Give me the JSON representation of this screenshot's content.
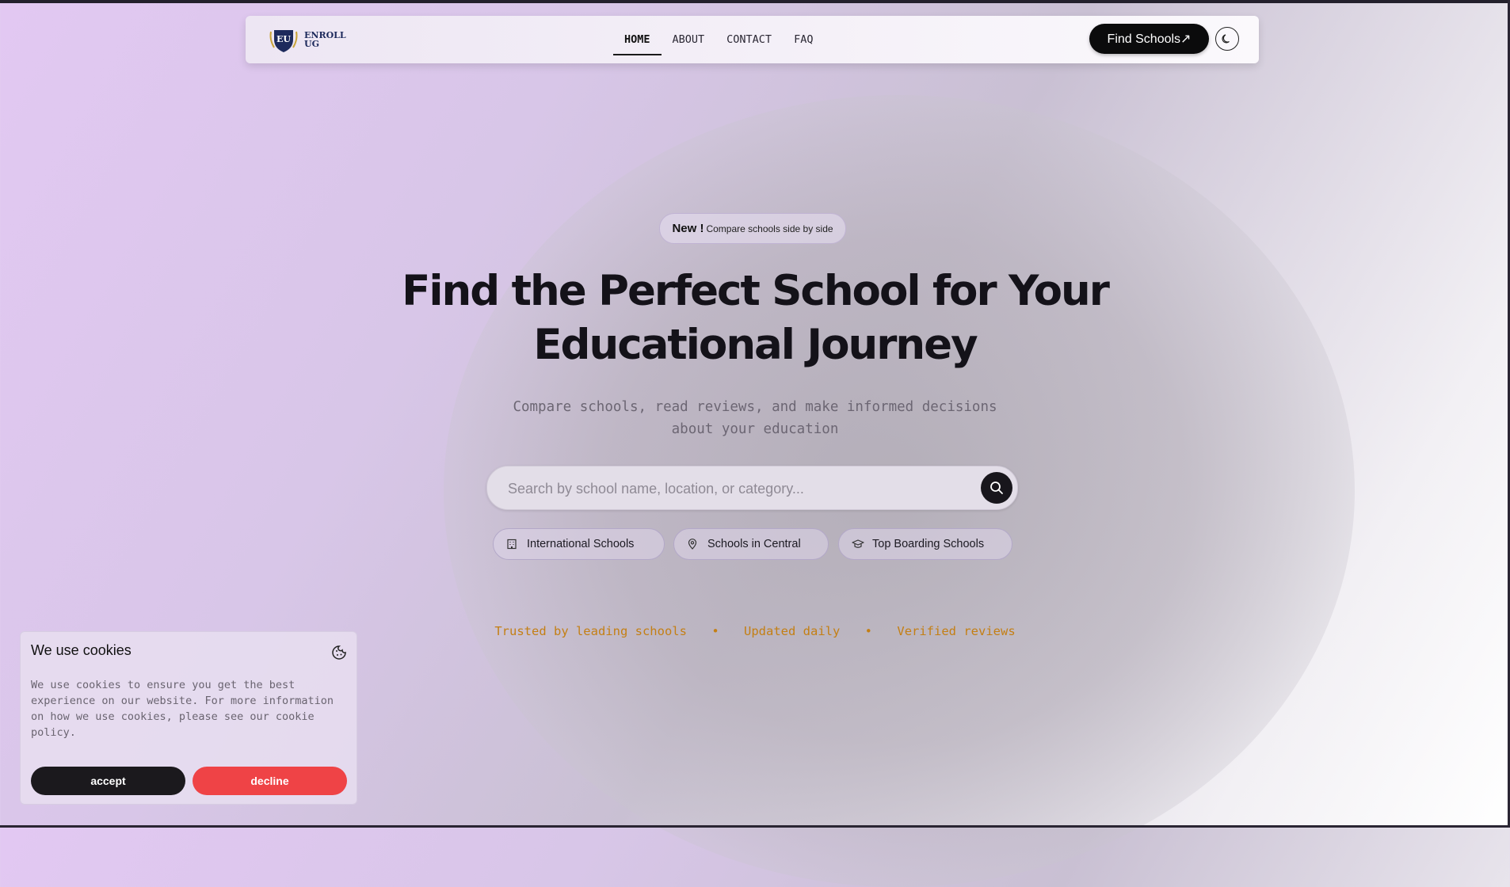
{
  "brand": {
    "logo_mark": "EU",
    "logo_text": "ENROLL UG"
  },
  "nav": {
    "links": [
      {
        "label": "HOME",
        "active": true
      },
      {
        "label": "ABOUT",
        "active": false
      },
      {
        "label": "CONTACT",
        "active": false
      },
      {
        "label": "FAQ",
        "active": false
      }
    ],
    "cta_label": "Find Schools↗",
    "theme_icon": "moon-icon"
  },
  "hero": {
    "badge_new": "New !",
    "badge_text": "Compare schools side by side",
    "title_line1": "Find the Perfect School for Your",
    "title_line2": "Educational Journey",
    "subtitle_line1": "Compare schools, read reviews, and make informed decisions",
    "subtitle_line2": "about your education"
  },
  "search": {
    "placeholder": "Search by school name, location, or category...",
    "button_icon": "search-icon"
  },
  "quick_filters": [
    {
      "label": "International Schools",
      "icon": "building-icon"
    },
    {
      "label": "Schools in Central",
      "icon": "map-pin-icon"
    },
    {
      "label": "Top Boarding Schools",
      "icon": "graduation-cap-icon"
    }
  ],
  "trust": [
    "Trusted by leading schools",
    "Updated daily",
    "Verified reviews"
  ],
  "cookie": {
    "title": "We use cookies",
    "text": "We use cookies to ensure you get the best experience on our website. For more information on how we use cookies, please see our cookie policy.",
    "accept_label": "accept",
    "decline_label": "decline",
    "icon": "cookie-icon"
  },
  "colors": {
    "accent_dark": "#0b0b0c",
    "trust_text": "#c47f14",
    "decline": "#ef4346",
    "logo_navy": "#1d2a5c"
  }
}
